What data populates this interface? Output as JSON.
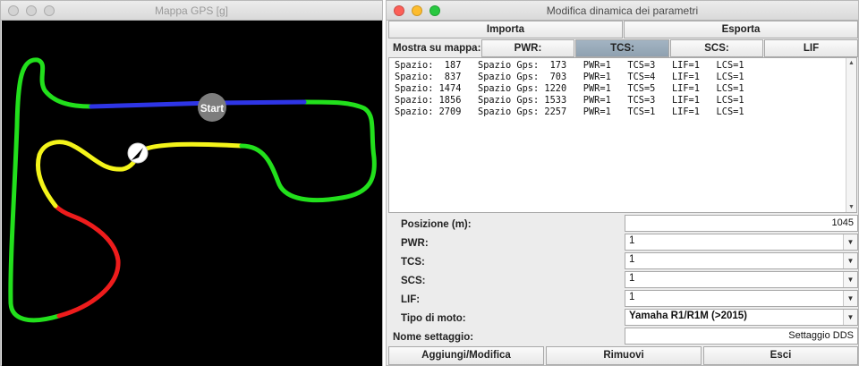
{
  "map_window": {
    "title": "Mappa GPS [g]",
    "start_label": "Start",
    "track_colors": {
      "green": "#22e01c",
      "blue": "#2e35e6",
      "yellow": "#f4f41a",
      "red": "#ee1c1c"
    }
  },
  "param_window": {
    "title": "Modifica dinamica dei parametri",
    "import_label": "Importa",
    "export_label": "Esporta",
    "show_on_map_label": "Mostra su mappa:",
    "map_tabs": [
      {
        "label": "PWR:",
        "active": false
      },
      {
        "label": "TCS:",
        "active": true
      },
      {
        "label": "SCS:",
        "active": false
      },
      {
        "label": "LIF",
        "active": false
      }
    ],
    "list_rows": [
      "Spazio:  187   Spazio Gps:  173   PWR=1   TCS=3   LIF=1   LCS=1",
      "Spazio:  837   Spazio Gps:  703   PWR=1   TCS=4   LIF=1   LCS=1",
      "Spazio: 1474   Spazio Gps: 1220   PWR=1   TCS=5   LIF=1   LCS=1",
      "Spazio: 1856   Spazio Gps: 1533   PWR=1   TCS=3   LIF=1   LCS=1",
      "Spazio: 2709   Spazio Gps: 2257   PWR=1   TCS=1   LIF=1   LCS=1"
    ],
    "position_label": "Posizione (m):",
    "position_value": "1045",
    "pwr_label": "PWR:",
    "pwr_value": "1",
    "tcs_label": "TCS:",
    "tcs_value": "1",
    "scs_label": "SCS:",
    "scs_value": "1",
    "lif_label": "LIF:",
    "lif_value": "1",
    "moto_label": "Tipo di moto:",
    "moto_value": "Yamaha R1/R1M (>2015)",
    "setting_label": "Nome settaggio:",
    "setting_value": "Settaggio DDS",
    "add_label": "Aggiungi/Modifica",
    "remove_label": "Rimuovi",
    "exit_label": "Esci"
  }
}
